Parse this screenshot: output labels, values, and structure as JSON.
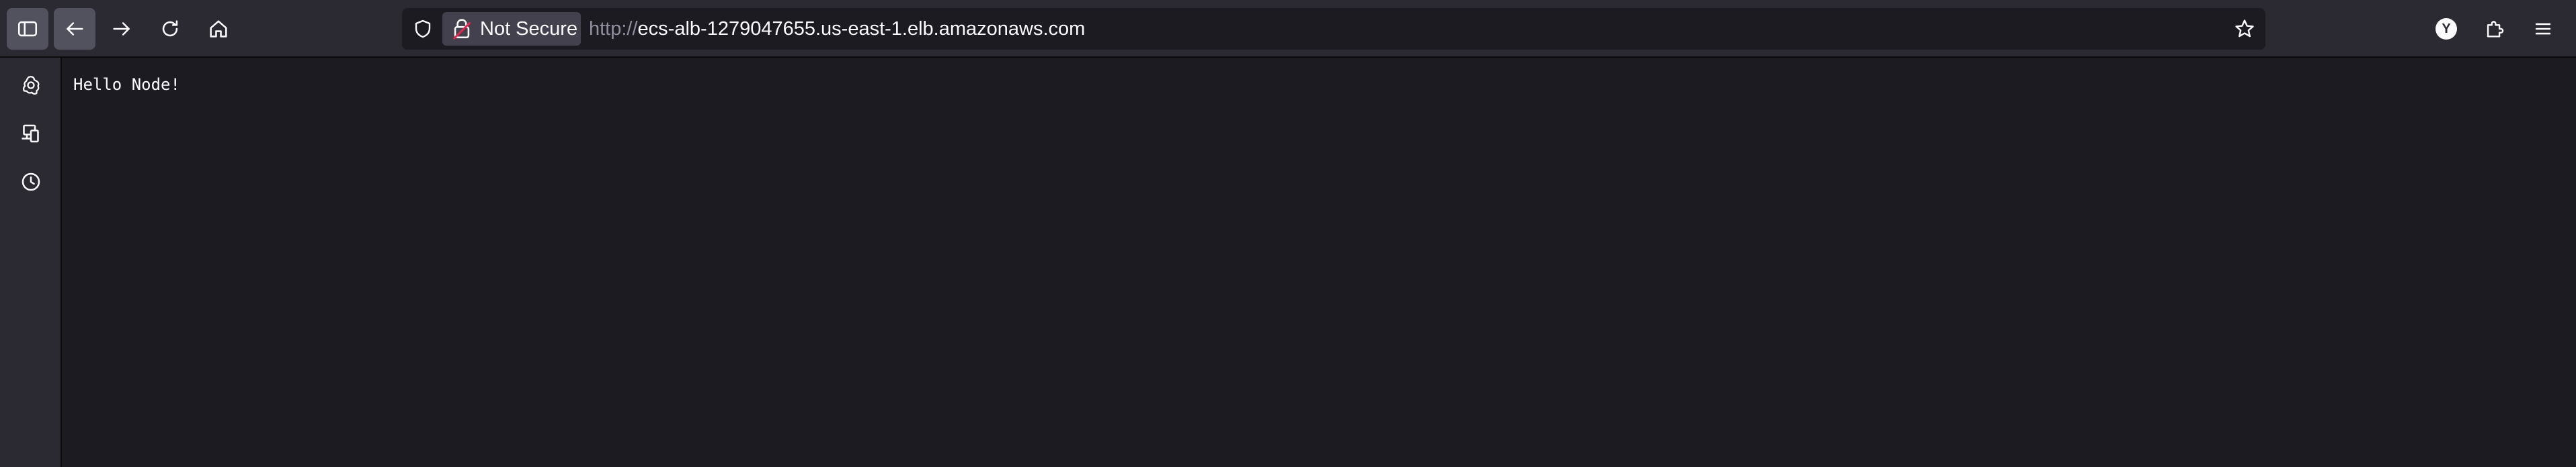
{
  "toolbar": {
    "sidebar_toggle_icon": "sidebar-icon",
    "back_icon": "arrow-left-icon",
    "forward_icon": "arrow-right-icon",
    "reload_icon": "reload-icon",
    "home_icon": "home-icon",
    "account_initial": "Y",
    "extensions_icon": "puzzle-icon",
    "menu_icon": "hamburger-icon"
  },
  "urlbar": {
    "security_label": "Not Secure",
    "url_scheme": "http://",
    "url_host": "ecs-alb-1279047655.us-east-1.elb.amazonaws.com",
    "shield_icon": "shield-icon",
    "lock_icon": "insecure-lock-icon",
    "bookmark_icon": "star-icon"
  },
  "sidebar": {
    "items": [
      {
        "icon": "ai-chatbot-icon"
      },
      {
        "icon": "synced-tabs-icon"
      },
      {
        "icon": "history-clock-icon"
      }
    ]
  },
  "page": {
    "body_text": "Hello Node!"
  },
  "colors": {
    "toolbar_bg": "#2b2a33",
    "content_bg": "#1c1b22",
    "text": "#fbfbfe",
    "muted_text": "#8f8f9d",
    "insecure_accent": "#e22850"
  }
}
